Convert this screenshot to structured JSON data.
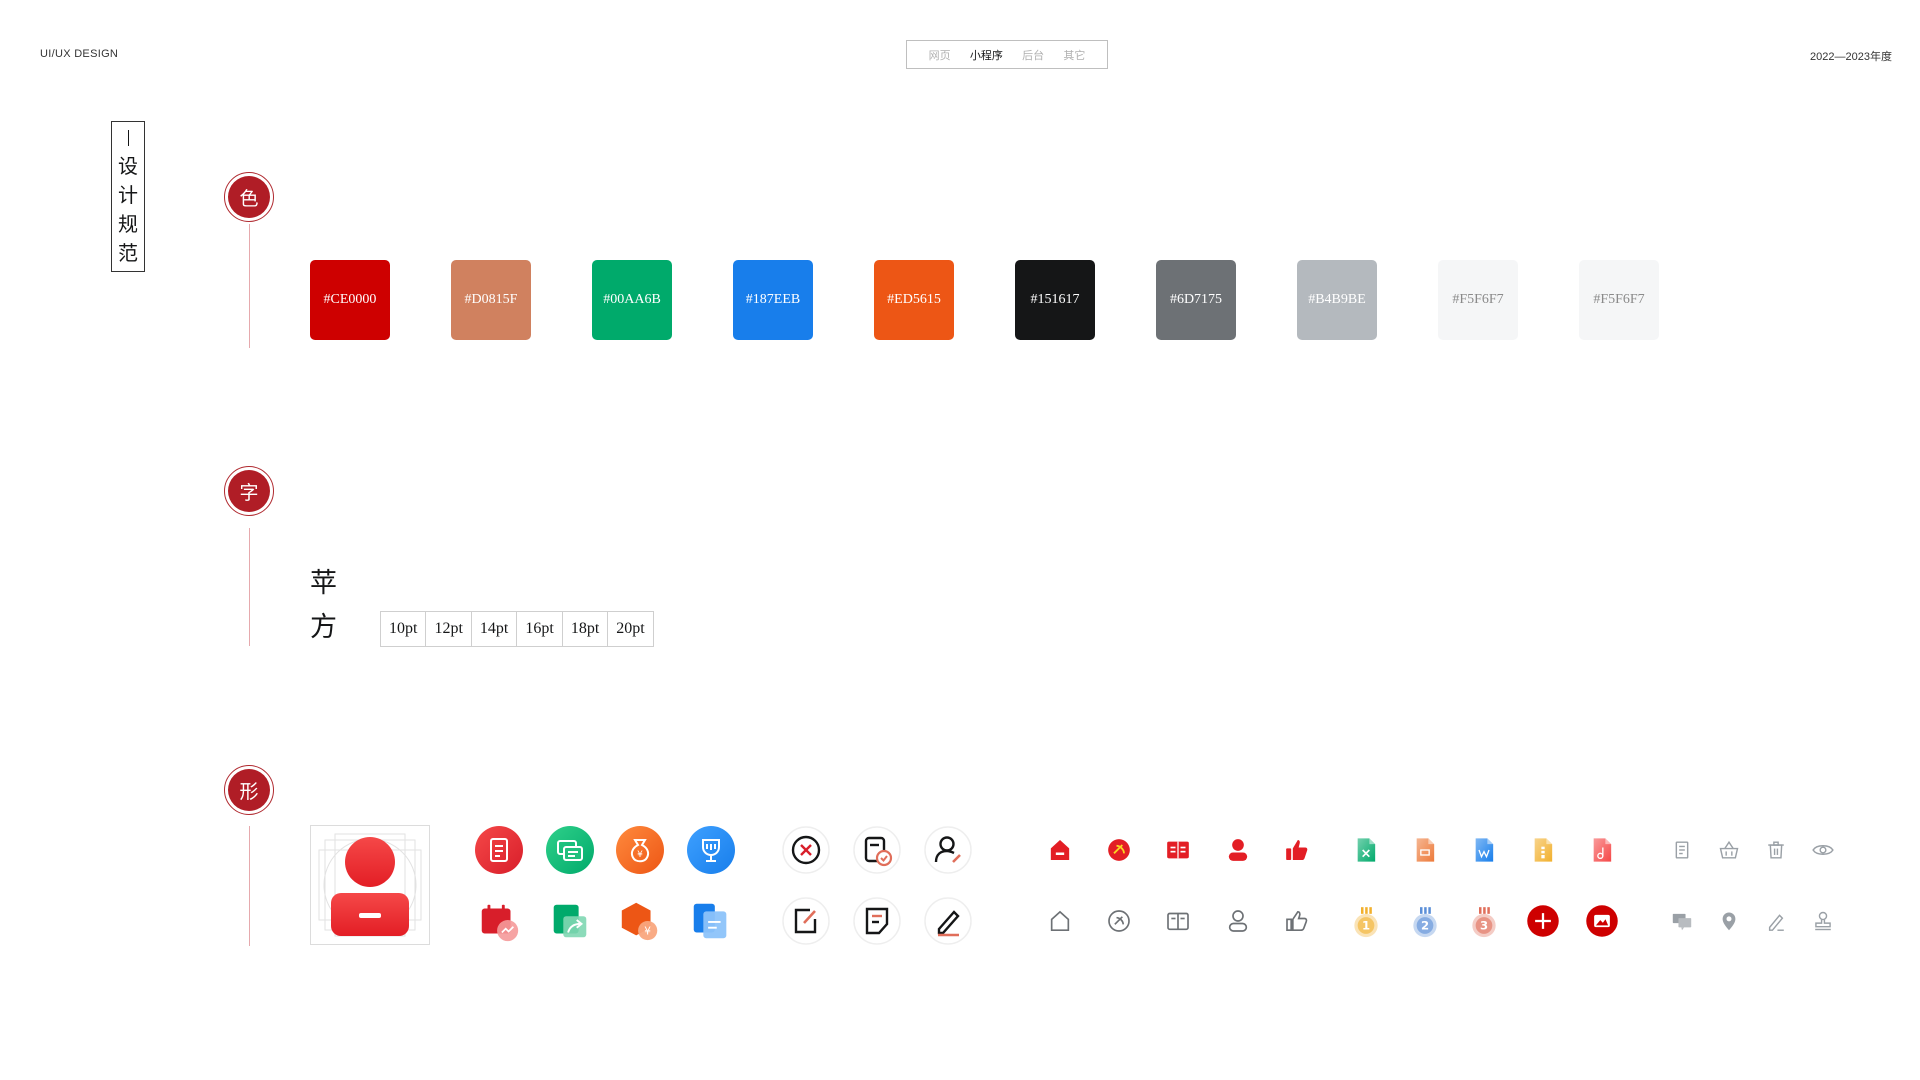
{
  "header": {
    "brand": "UI/UX DESIGN",
    "year": "2022—2023年度",
    "nav": [
      {
        "label": "网页",
        "active": false
      },
      {
        "label": "小程序",
        "active": true
      },
      {
        "label": "后台",
        "active": false
      },
      {
        "label": "其它",
        "active": false
      }
    ]
  },
  "sidebar": {
    "title_chars": [
      "设",
      "计",
      "规",
      "范"
    ]
  },
  "sections": {
    "color": "色",
    "type": "字",
    "shape": "形"
  },
  "colors": [
    {
      "hex": "#CE0000",
      "label": "#CE0000"
    },
    {
      "hex": "#D0815F",
      "label": "#D0815F"
    },
    {
      "hex": "#00AA6B",
      "label": "#00AA6B"
    },
    {
      "hex": "#187EEB",
      "label": "#187EEB"
    },
    {
      "hex": "#ED5615",
      "label": "#ED5615"
    },
    {
      "hex": "#151617",
      "label": "#151617"
    },
    {
      "hex": "#6D7175",
      "label": "#6D7175"
    },
    {
      "hex": "#B4B9BE",
      "label": "#B4B9BE"
    },
    {
      "hex": "#F5F6F7",
      "label": "#F5F6F7"
    },
    {
      "hex": "#F5F6F7",
      "label": "#F5F6F7"
    }
  ],
  "typography": {
    "font_chars": [
      "苹",
      "方"
    ],
    "sizes": [
      "10pt",
      "12pt",
      "14pt",
      "16pt",
      "18pt",
      "20pt"
    ]
  },
  "icons": {
    "avatar": "user-avatar-icon",
    "group1": [
      "document-icon",
      "chat-icon",
      "money-bag-icon",
      "trophy-icon",
      "calendar-chart-icon",
      "share-icon",
      "yuan-hexagon-icon",
      "files-icon"
    ],
    "group2": [
      "close-circle-icon",
      "task-check-icon",
      "user-edit-icon",
      "edit-square-icon",
      "note-icon",
      "pen-icon"
    ],
    "group3_active": [
      "home-icon",
      "party-emblem-icon",
      "book-icon",
      "person-icon",
      "thumbs-up-icon"
    ],
    "group3_inactive": [
      "home-outline-icon",
      "emblem-outline-icon",
      "book-outline-icon",
      "person-outline-icon",
      "thumbs-up-outline-icon"
    ],
    "group4_files": [
      "excel-file-icon",
      "ppt-file-icon",
      "word-file-icon",
      "zip-file-icon",
      "audio-file-icon"
    ],
    "group4_medals": [
      {
        "name": "gold-medal-icon",
        "rank": "1"
      },
      {
        "name": "silver-medal-icon",
        "rank": "2"
      },
      {
        "name": "bronze-medal-icon",
        "rank": "3"
      }
    ],
    "group4_actions": [
      "add-circle-icon",
      "image-circle-icon"
    ],
    "group5": [
      "file-list-icon",
      "basket-icon",
      "trash-icon",
      "eye-icon",
      "message-icon",
      "location-icon",
      "pencil-icon",
      "stamp-icon"
    ],
    "colors": {
      "red": "#CE0000",
      "red_light": "#F54848",
      "green": "#00AA6B",
      "blue": "#187EEB",
      "orange": "#ED5615",
      "dark": "#151617",
      "gray": "#6D7175",
      "light_gray": "#B4B9BE",
      "gold": "#F2B02D",
      "silver": "#5B8FD8",
      "bronze": "#E06E5A"
    }
  }
}
